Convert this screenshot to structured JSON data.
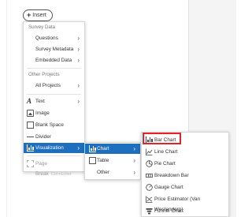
{
  "insert_button": {
    "label": "Insert"
  },
  "main_menu": {
    "survey_data_header": "Survey Data",
    "questions": "Questions",
    "survey_metadata": "Survey Metadata",
    "embedded_data": "Embedded Data",
    "other_projects_header": "Other Projects",
    "all_projects": "All Projects",
    "text": "Text",
    "image": "Image",
    "blank_space": "Blank Space",
    "divider": "Divider",
    "visualization": "Visualization",
    "page_break": "Page Break",
    "page_break_shortcut": "Ctrl+Enter"
  },
  "visualization_submenu": {
    "chart": "Chart",
    "table": "Table",
    "other": "Other"
  },
  "chart_types": {
    "bar_chart": "Bar Chart",
    "line_chart": "Line Chart",
    "pie_chart": "Pie Chart",
    "breakdown_bar": "Breakdown Bar",
    "gauge_chart": "Gauge Chart",
    "price_estimator": "Price Estimator (Van Westendorp)",
    "funnel_chart": "Funnel Chart"
  },
  "colors": {
    "active_item": "#1e70bf",
    "highlight": "#e8202a"
  }
}
